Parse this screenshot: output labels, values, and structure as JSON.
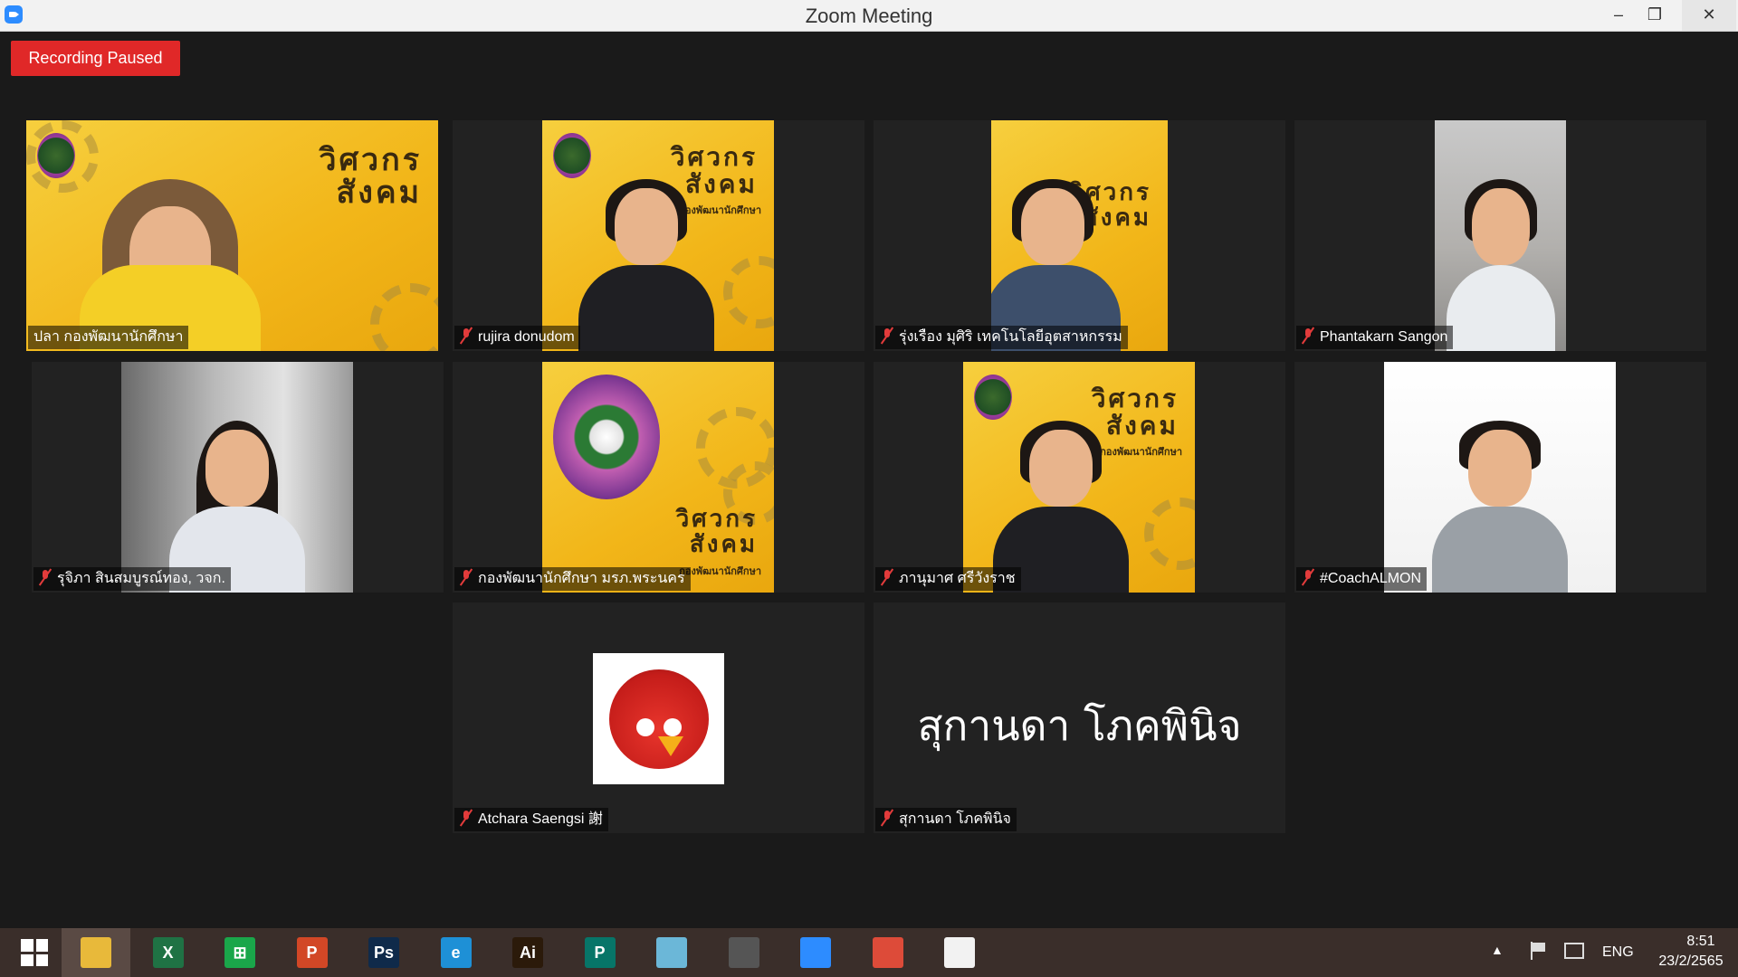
{
  "window": {
    "title": "Zoom Meeting",
    "minimize": "–",
    "maximize": "❐",
    "close": "✕"
  },
  "recording": {
    "label": "Recording Paused"
  },
  "participants": [
    {
      "name": "ปลา กองพัฒนานักศึกษา",
      "muted": false,
      "active": true
    },
    {
      "name": "rujira donudom",
      "muted": true
    },
    {
      "name": "รุ่งเรือง มุศิริ เทคโนโลยีอุตสาหกรรม",
      "muted": true
    },
    {
      "name": "Phantakarn Sangon",
      "muted": true
    },
    {
      "name": "รุจิภา สินสมบูรณ์ทอง, วจก.",
      "muted": true
    },
    {
      "name": "กองพัฒนานักศึกษา มรภ.พระนคร",
      "muted": true
    },
    {
      "name": "ภานุมาศ ศรีวังราช",
      "muted": true
    },
    {
      "name": "#CoachALMON",
      "muted": true
    },
    {
      "name": "Atchara Saengsi 謝",
      "muted": true
    },
    {
      "name": "สุกานดา โภคพินิจ",
      "muted": true,
      "display_text": "สุกานดา โภคพินิจ"
    }
  ],
  "poster": {
    "title_line1": "วิศวกร",
    "title_line2": "สังคม",
    "subtitle": "กองพัฒนานักศึกษา"
  },
  "taskbar": {
    "apps": [
      {
        "name": "file-explorer",
        "label": "",
        "color": "#e8b93a"
      },
      {
        "name": "excel",
        "label": "X",
        "color": "#1f7244"
      },
      {
        "name": "store",
        "label": "⊞",
        "color": "#1aa64a"
      },
      {
        "name": "powerpoint",
        "label": "P",
        "color": "#d24726"
      },
      {
        "name": "photoshop",
        "label": "Ps",
        "color": "#0f2a4a"
      },
      {
        "name": "internet-explorer",
        "label": "e",
        "color": "#1e90d6"
      },
      {
        "name": "illustrator",
        "label": "Ai",
        "color": "#2b1a0a"
      },
      {
        "name": "publisher",
        "label": "P",
        "color": "#077568"
      },
      {
        "name": "notes",
        "label": "",
        "color": "#6bb7d8"
      },
      {
        "name": "photoscape",
        "label": "",
        "color": "#555555"
      },
      {
        "name": "zoom",
        "label": "",
        "color": "#2d8cff"
      },
      {
        "name": "chrome",
        "label": "",
        "color": "#dd4b39"
      },
      {
        "name": "paint",
        "label": "",
        "color": "#f2f2f2"
      }
    ],
    "lang": "ENG",
    "time": "8:51",
    "date": "23/2/2565"
  }
}
